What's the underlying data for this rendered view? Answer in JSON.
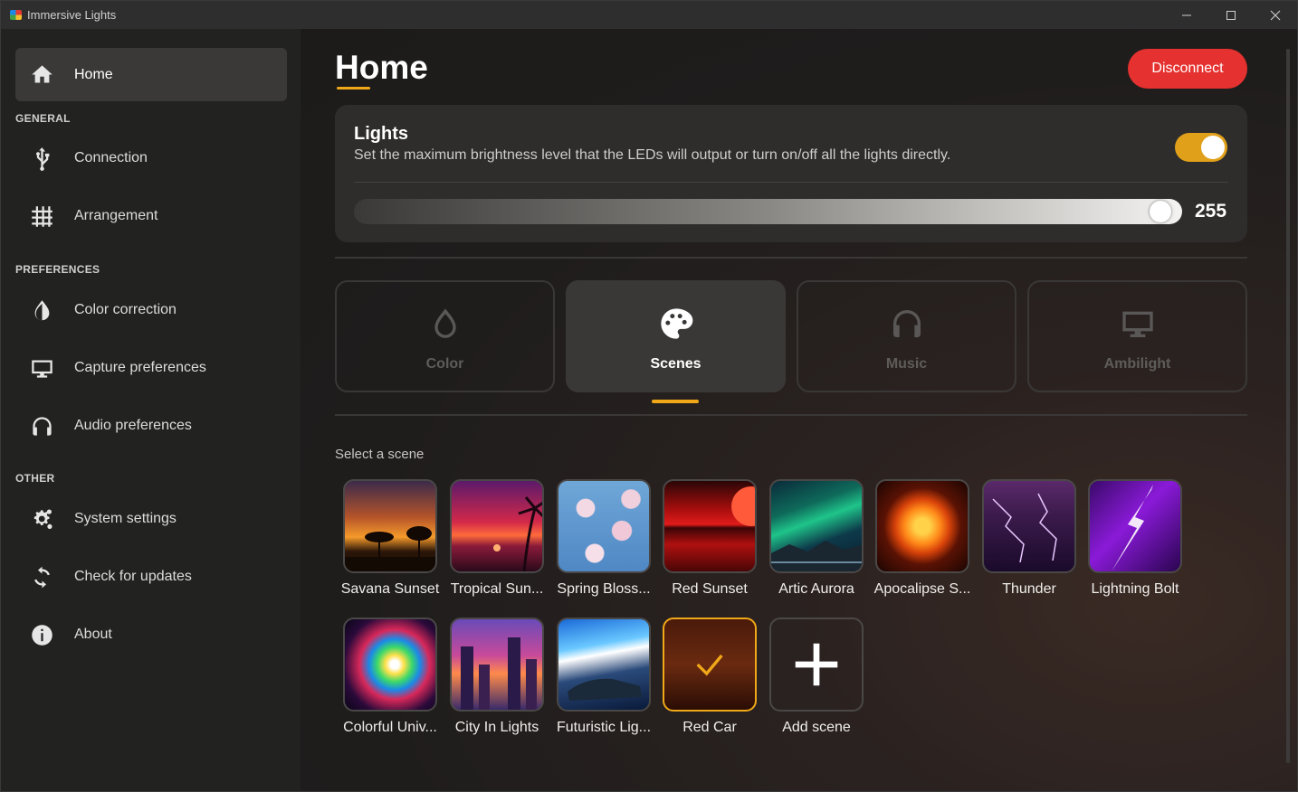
{
  "window": {
    "title": "Immersive Lights",
    "minimize_icon": "minimize-icon",
    "maximize_icon": "maximize-icon",
    "close_icon": "close-icon"
  },
  "sidebar": {
    "home": {
      "label": "Home",
      "icon": "home-icon"
    },
    "sections": [
      {
        "label": "GENERAL"
      },
      {
        "label": "PREFERENCES"
      },
      {
        "label": "OTHER"
      }
    ],
    "items": [
      {
        "label": "Connection",
        "icon": "usb-icon"
      },
      {
        "label": "Arrangement",
        "icon": "grid-icon"
      },
      {
        "label": "Color correction",
        "icon": "contrast-drop-icon"
      },
      {
        "label": "Capture preferences",
        "icon": "monitor-icon"
      },
      {
        "label": "Audio preferences",
        "icon": "headphones-icon"
      },
      {
        "label": "System settings",
        "icon": "gears-icon"
      },
      {
        "label": "Check for updates",
        "icon": "refresh-icon"
      },
      {
        "label": "About",
        "icon": "info-icon"
      }
    ]
  },
  "header": {
    "title": "Home",
    "disconnect_label": "Disconnect"
  },
  "lights": {
    "title": "Lights",
    "description": "Set the maximum brightness level that the LEDs will output or turn on/off all the lights directly.",
    "enabled": true,
    "brightness": 255,
    "brightness_max": 255,
    "toggle_color": "#e0a01a"
  },
  "modes": [
    {
      "label": "Color",
      "icon": "drop-icon",
      "active": false
    },
    {
      "label": "Scenes",
      "icon": "palette-icon",
      "active": true
    },
    {
      "label": "Music",
      "icon": "headphones-icon",
      "active": false
    },
    {
      "label": "Ambilight",
      "icon": "monitor-icon",
      "active": false
    }
  ],
  "scenes": {
    "label": "Select a scene",
    "items": [
      {
        "name": "Savana Sunset"
      },
      {
        "name": "Tropical Sun..."
      },
      {
        "name": "Spring Bloss..."
      },
      {
        "name": "Red Sunset"
      },
      {
        "name": "Artic Aurora"
      },
      {
        "name": "Apocalipse S..."
      },
      {
        "name": "Thunder"
      },
      {
        "name": "Lightning Bolt"
      },
      {
        "name": "Colorful Univ..."
      },
      {
        "name": "City In Lights"
      },
      {
        "name": "Futuristic Lig..."
      },
      {
        "name": "Red Car",
        "selected": true
      }
    ],
    "add_label": "Add scene"
  },
  "colors": {
    "accent": "#f0a818",
    "disconnect": "#e5312f"
  }
}
